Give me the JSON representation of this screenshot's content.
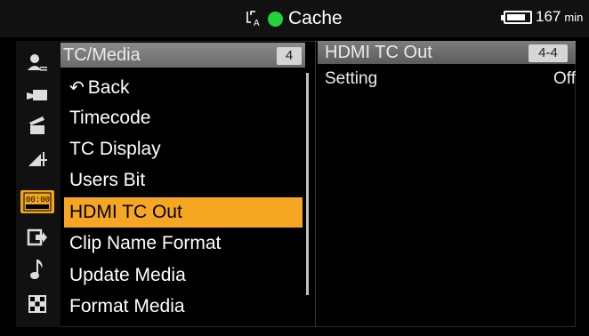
{
  "status_bar": {
    "media_icon": "card-slot-a-icon",
    "cache_label": "Cache",
    "cache_indicator_color": "#22d33a",
    "battery_icon": "battery-icon",
    "battery_level": 0.85,
    "battery_value": "167",
    "battery_unit": "min"
  },
  "sidebar": {
    "icons": [
      "user-menu-icon",
      "camera-icon",
      "clapperboard-icon",
      "picture-profile-icon",
      "tc-media-icon",
      "output-icon",
      "audio-note-icon",
      "grid-icon"
    ],
    "active_index": 4,
    "active_color": "#f1a51a",
    "active_icon_text": "00:00"
  },
  "menu": {
    "title": "TC/Media",
    "page": "4",
    "items": [
      {
        "label": "Back",
        "icon": "back-arrow-icon"
      },
      {
        "label": "Timecode"
      },
      {
        "label": "TC Display"
      },
      {
        "label": "Users Bit"
      },
      {
        "label": "HDMI TC Out"
      },
      {
        "label": "Clip Name Format"
      },
      {
        "label": "Update Media"
      },
      {
        "label": "Format Media"
      }
    ],
    "selected_index": 4,
    "highlight_color": "#f5a623"
  },
  "detail": {
    "title": "HDMI TC Out",
    "page": "4-4",
    "setting_label": "Setting",
    "setting_value": "Off"
  }
}
